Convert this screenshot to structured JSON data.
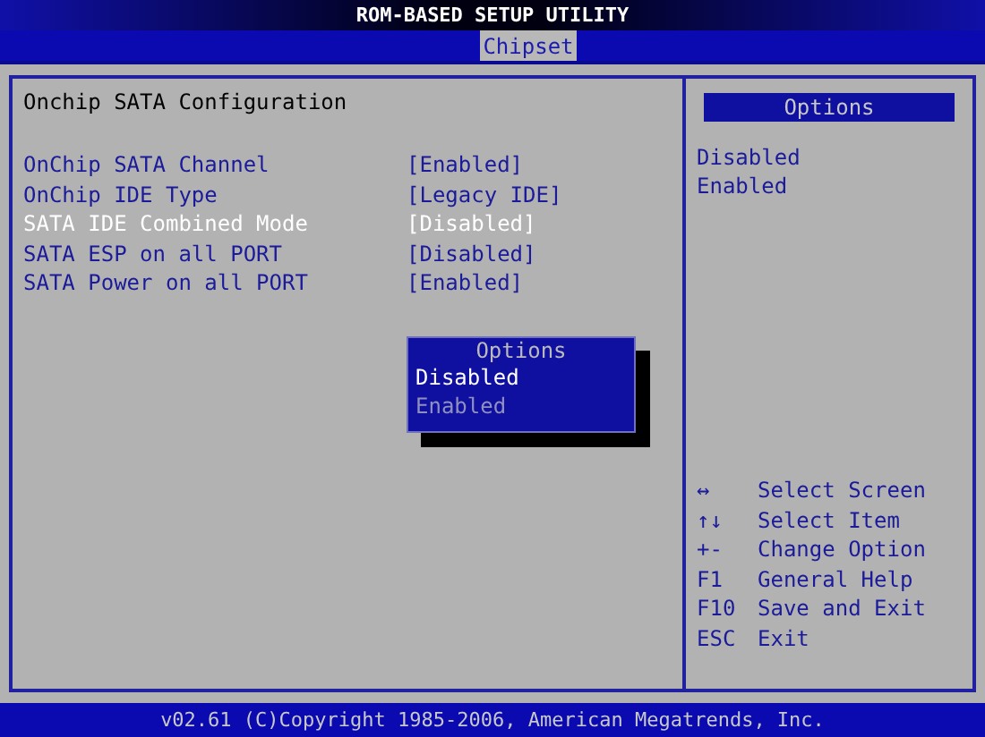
{
  "window": {
    "title": "ROM-BASED SETUP UTILITY"
  },
  "tabs": [
    {
      "label": "Chipset",
      "selected": true
    }
  ],
  "section": {
    "title": "Onchip SATA Configuration"
  },
  "settings": [
    {
      "label": "OnChip SATA Channel",
      "value": "[Enabled]",
      "selected": false
    },
    {
      "label": "OnChip IDE Type",
      "value": "[Legacy IDE]",
      "selected": false
    },
    {
      "label": "SATA IDE Combined Mode",
      "value": "[Disabled]",
      "selected": true
    },
    {
      "label": "SATA ESP on all PORT",
      "value": "[Disabled]",
      "selected": false
    },
    {
      "label": "SATA Power on all PORT",
      "value": "[Enabled]",
      "selected": false
    }
  ],
  "popup": {
    "title": "Options",
    "options": [
      {
        "label": "Disabled",
        "selected": true
      },
      {
        "label": "Enabled",
        "selected": false
      }
    ]
  },
  "side_panel": {
    "title": "Options",
    "items": [
      "Disabled",
      "Enabled"
    ],
    "help": [
      {
        "key": "↔",
        "action": "Select Screen"
      },
      {
        "key": "↑↓",
        "action": "Select Item"
      },
      {
        "key": "+-",
        "action": "Change Option"
      },
      {
        "key": "F1",
        "action": "General Help"
      },
      {
        "key": "F10",
        "action": "Save and Exit"
      },
      {
        "key": "ESC",
        "action": "Exit"
      }
    ]
  },
  "status_bar": {
    "text": "v02.61 (C)Copyright 1985-2006, American Megatrends, Inc."
  }
}
